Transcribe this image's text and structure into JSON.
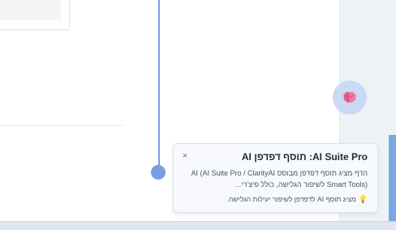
{
  "popup": {
    "title": "AI Suite Pro: תוסף דפדפן AI",
    "description": "הדף מציג תוסף דפדפן מבוסס AI (AI Suite Pro / ClarityAI Smart Tools) לשיפור הגלישה, כולל פיצ'רי...",
    "note": "מציג תוסף AI לדפדפן לשיפור יעילות הגלישה.",
    "note_icon": "lightbulb-icon",
    "close_label": "×"
  },
  "assistant_button": {
    "icon": "brain-icon"
  },
  "colors": {
    "timeline": "#7a9ee6",
    "assistant_bg": "#c9daf4",
    "brain": "#e8588a",
    "scroll_accent": "#79a8e0"
  }
}
